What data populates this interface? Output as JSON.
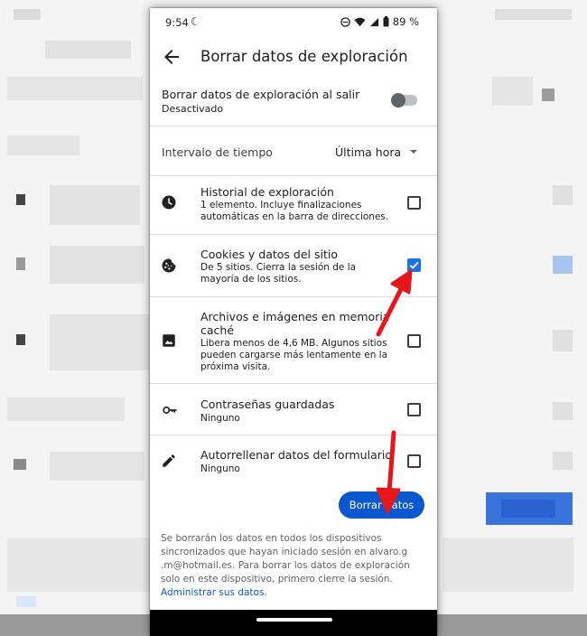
{
  "status": {
    "time": "9:54",
    "battery": "89 %"
  },
  "header": {
    "title": "Borrar datos de exploración"
  },
  "exit_setting": {
    "title": "Borrar datos de exploración al salir",
    "subtitle": "Desactivado",
    "enabled": false
  },
  "interval": {
    "label": "Intervalo de tiempo",
    "value": "Última hora"
  },
  "items": [
    {
      "icon": "clock-icon",
      "title": "Historial de exploración",
      "desc": "1 elemento. Incluye finalizaciones automáticas en la barra de direcciones.",
      "checked": false
    },
    {
      "icon": "cookie-icon",
      "title": "Cookies y datos del sitio",
      "desc": "De 5 sitios. Cierra la sesión de la mayoría de los sitios.",
      "checked": true
    },
    {
      "icon": "image-icon",
      "title": "Archivos e imágenes en memoria caché",
      "desc": "Libera menos de 4,6 MB. Algunos sitios pueden cargarse más lentamente en la próxima visita.",
      "checked": false
    },
    {
      "icon": "key-icon",
      "title": "Contraseñas guardadas",
      "desc": "Ninguno",
      "checked": false
    },
    {
      "icon": "pencil-icon",
      "title": "Autorrellenar datos del formulario",
      "desc": "Ninguno",
      "checked": false
    }
  ],
  "clear_button": "Borrar datos",
  "footer": {
    "text": "Se borrarán los datos en todos los dispositivos sincronizados que hayan iniciado sesión en alvaro.g .m@hotmail.es. Para borrar los datos de exploración solo en este dispositivo, primero cierre la sesión.",
    "link": "Administrar sus datos."
  },
  "colors": {
    "accent": "#0b57d0",
    "checkbox": "#1a73e8",
    "annotation_arrow": "#e8151b"
  }
}
